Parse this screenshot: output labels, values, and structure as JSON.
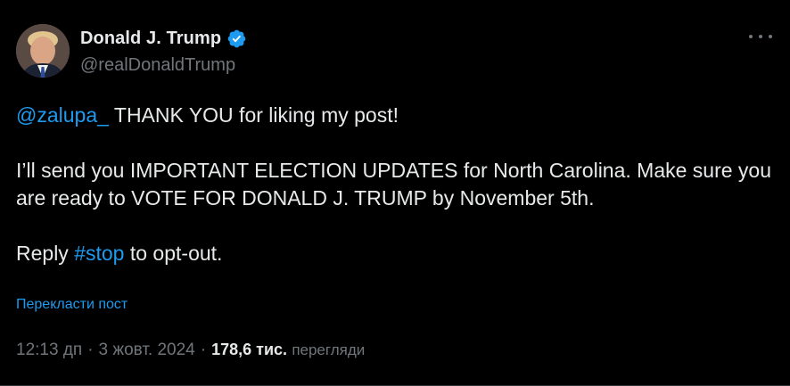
{
  "author": {
    "display_name": "Donald J. Trump",
    "handle": "@realDonaldTrump",
    "verified": true,
    "avatar_icon": "profile-photo-icon"
  },
  "more_icon": "more-dots-icon",
  "tweet": {
    "mention": "@zalupa_",
    "line1_rest": " THANK YOU for liking my post!",
    "paragraph2": "I’ll send you IMPORTANT ELECTION UPDATES for North Carolina. Make sure you are ready to VOTE FOR DONALD J. TRUMP by November 5th.",
    "reply_prefix": "Reply ",
    "hashtag": "#stop",
    "reply_suffix": " to opt-out."
  },
  "translate_label": "Перекласти пост",
  "meta": {
    "time": "12:13 дп",
    "separator": "·",
    "date": "3 жовт. 2024",
    "views_count": "178,6 тис.",
    "views_label": "перегляди"
  },
  "colors": {
    "background": "#000000",
    "text": "#e7e9ea",
    "secondary": "#71767b",
    "accent": "#1d9bf0"
  }
}
